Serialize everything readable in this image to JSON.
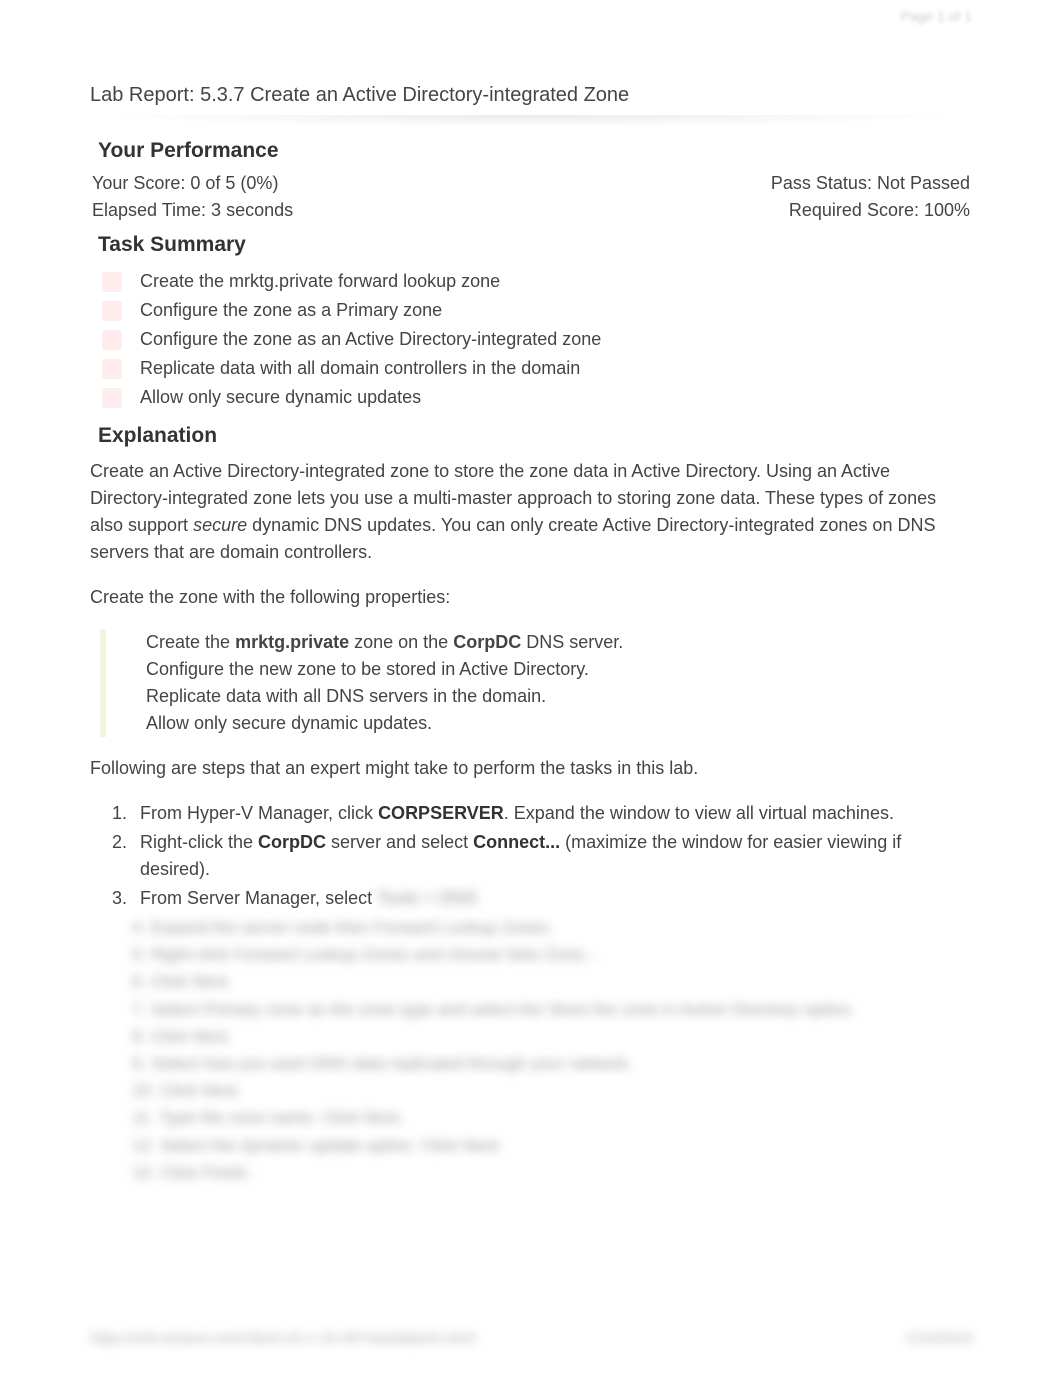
{
  "page_indicator": "Page 1 of 1",
  "report_title": "Lab Report: 5.3.7 Create an Active Directory-integrated Zone",
  "performance": {
    "heading": "Your Performance",
    "score_label": "Your Score: 0 of 5 (0%)",
    "pass_label": "Pass Status: Not Passed",
    "elapsed_label": "Elapsed Time: 3 seconds",
    "required_label": "Required Score: 100%"
  },
  "task_summary": {
    "heading": "Task Summary",
    "items": [
      "Create the mrktg.private forward lookup zone",
      "Configure the zone as a Primary zone",
      "Configure the zone as an Active Directory-integrated zone",
      "Replicate data with all domain controllers in the domain",
      "Allow only secure dynamic updates"
    ]
  },
  "explanation": {
    "heading": "Explanation",
    "para1_pre": "Create an Active Directory-integrated zone to store the zone data in Active Directory. Using an Active Directory-integrated zone lets you use a multi-master approach to storing zone data. These types of zones also support ",
    "para1_em": "secure",
    "para1_post": " dynamic DNS updates. You can only create Active Directory-integrated zones on DNS servers that are domain controllers.",
    "para2": "Create the zone with the following properties:",
    "callout": {
      "l1_pre": "Create the ",
      "l1_b1": "mrktg.private",
      "l1_mid": " zone on the ",
      "l1_b2": "CorpDC",
      "l1_post": " DNS server.",
      "l2": "Configure the new zone to be stored in Active Directory.",
      "l3": "Replicate data with all DNS servers in the domain.",
      "l4": "Allow only secure dynamic updates."
    },
    "para3": "Following are steps that an expert might take to perform the tasks in this lab.",
    "steps": {
      "s1_pre": "From Hyper-V Manager, click ",
      "s1_b": "CORPSERVER",
      "s1_post": ". Expand the window to view all virtual machines.",
      "s2_pre": "Right-click the ",
      "s2_b1": "CorpDC",
      "s2_mid": " server and select ",
      "s2_b2": "Connect...",
      "s2_post": " (maximize the window for easier viewing if desired).",
      "s3_pre": "From Server Manager, select ",
      "s3_blur": "Tools > DNS"
    },
    "blurred_lines": [
      "4.  Expand the server node then Forward Lookup Zones.",
      "5.  Right-click Forward Lookup Zones and choose New Zone...",
      "6.  Click Next.",
      "7.  Select Primary zone as the zone type and select the Store the zone in Active Directory option.",
      "8.  Click Next.",
      "9.  Select how you want DNS data replicated through your network.",
      "10. Click Next.",
      "11. Type the zone name. Click Next.",
      "12. Select the dynamic update option. Click Next.",
      "13. Click Finish."
    ]
  },
  "footer": {
    "left": "https://cdn.testout.com/client-v5-1-10-497/startlabsim.html",
    "right": "1/14/2019"
  }
}
